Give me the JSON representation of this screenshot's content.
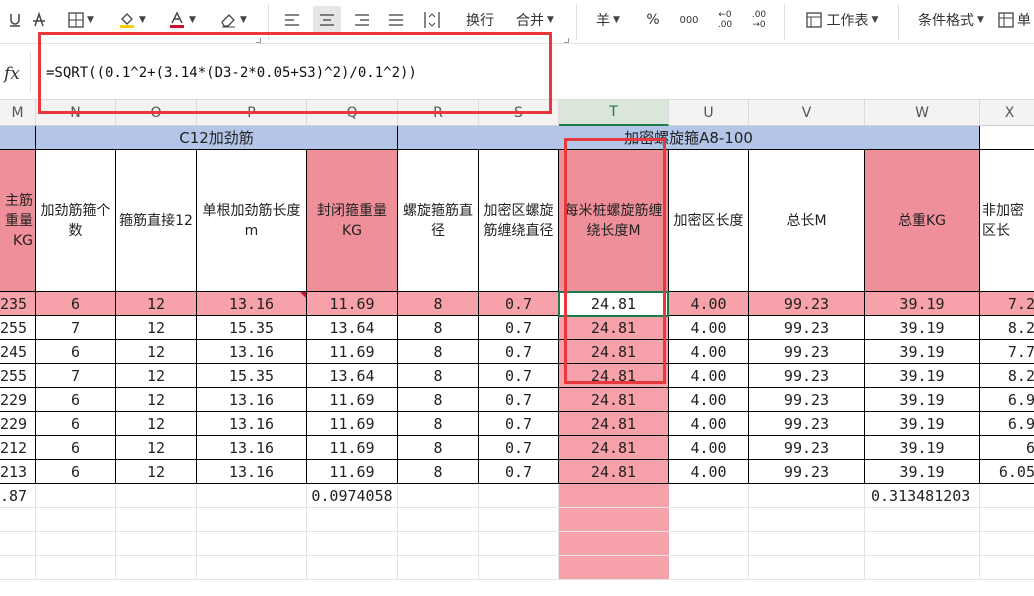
{
  "toolbar": {
    "wrap_label": "换行",
    "merge_label": "合并",
    "currency_symbol": "羊",
    "percent_symbol": "%",
    "thousands_symbol": "000",
    "dec_increase_symbol": "←0 .00",
    "dec_decrease_symbol": ".00 →0",
    "worksheet_label": "工作表",
    "cond_format_label": "条件格式",
    "cut_label": "单"
  },
  "formula_bar": {
    "fx_label": "fx",
    "formula": "=SQRT((0.1^2+(3.14*(D3-2*0.05+S3)^2)/0.1^2))"
  },
  "columns": [
    "M",
    "N",
    "O",
    "P",
    "Q",
    "R",
    "S",
    "T",
    "U",
    "V",
    "W",
    "X"
  ],
  "selected_column": "T",
  "group_headers": {
    "c12_label": "C12加劲筋",
    "spiral_label": "加密螺旋箍A8-100"
  },
  "headers": {
    "M": "主筋重量KG",
    "N": "加劲筋箍个数",
    "O": "箍筋直接12",
    "P": "单根加劲筋长度m",
    "Q": "封闭箍重量KG",
    "R": "螺旋箍筋直径",
    "S": "加密区螺旋筋缠绕直径",
    "T": "每米桩螺旋筋缠绕长度M",
    "U": "加密区长度",
    "V": "总长M",
    "W": "总重KG",
    "X": "非加密区长"
  },
  "rows": [
    {
      "M": "235",
      "N": "6",
      "O": "12",
      "P": "13.16",
      "Q": "11.69",
      "R": "8",
      "S": "0.7",
      "T": "24.81",
      "U": "4.00",
      "V": "99.23",
      "W": "39.19",
      "X": "7.2"
    },
    {
      "M": "255",
      "N": "7",
      "O": "12",
      "P": "15.35",
      "Q": "13.64",
      "R": "8",
      "S": "0.7",
      "T": "24.81",
      "U": "4.00",
      "V": "99.23",
      "W": "39.19",
      "X": "8.2"
    },
    {
      "M": "245",
      "N": "6",
      "O": "12",
      "P": "13.16",
      "Q": "11.69",
      "R": "8",
      "S": "0.7",
      "T": "24.81",
      "U": "4.00",
      "V": "99.23",
      "W": "39.19",
      "X": "7.7"
    },
    {
      "M": "255",
      "N": "7",
      "O": "12",
      "P": "15.35",
      "Q": "13.64",
      "R": "8",
      "S": "0.7",
      "T": "24.81",
      "U": "4.00",
      "V": "99.23",
      "W": "39.19",
      "X": "8.2"
    },
    {
      "M": "229",
      "N": "6",
      "O": "12",
      "P": "13.16",
      "Q": "11.69",
      "R": "8",
      "S": "0.7",
      "T": "24.81",
      "U": "4.00",
      "V": "99.23",
      "W": "39.19",
      "X": "6.9"
    },
    {
      "M": "229",
      "N": "6",
      "O": "12",
      "P": "13.16",
      "Q": "11.69",
      "R": "8",
      "S": "0.7",
      "T": "24.81",
      "U": "4.00",
      "V": "99.23",
      "W": "39.19",
      "X": "6.9"
    },
    {
      "M": "212",
      "N": "6",
      "O": "12",
      "P": "13.16",
      "Q": "11.69",
      "R": "8",
      "S": "0.7",
      "T": "24.81",
      "U": "4.00",
      "V": "99.23",
      "W": "39.19",
      "X": "6"
    },
    {
      "M": "213",
      "N": "6",
      "O": "12",
      "P": "13.16",
      "Q": "11.69",
      "R": "8",
      "S": "0.7",
      "T": "24.81",
      "U": "4.00",
      "V": "99.23",
      "W": "39.19",
      "X": "6.05"
    }
  ],
  "totals": {
    "M": ".87",
    "Q": "0.0974058",
    "W": "0.313481203"
  },
  "colors": {
    "group_blue": "#b4c6e7",
    "header_pink": "#ef8f99",
    "row_pink": "#f7a1aa",
    "highlight_red": "#e8383d",
    "active_green": "#1d7b4b"
  }
}
